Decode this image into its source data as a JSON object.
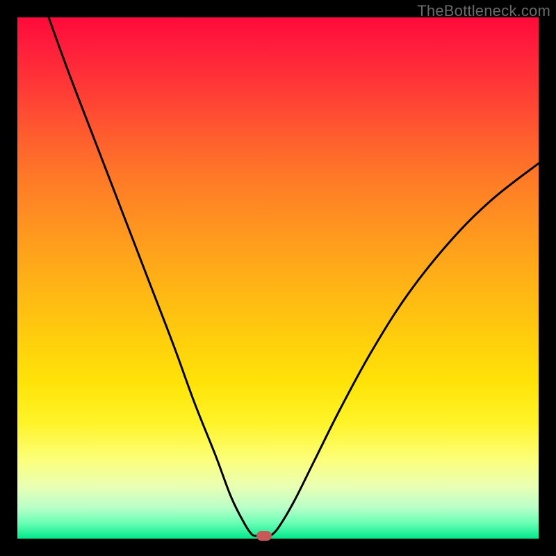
{
  "watermark": "TheBottleneck.com",
  "colors": {
    "frame": "#000000",
    "curve": "#000000",
    "marker": "#c75a58"
  },
  "chart_data": {
    "type": "line",
    "title": "",
    "xlabel": "",
    "ylabel": "",
    "xlim": [
      0,
      100
    ],
    "ylim": [
      0,
      100
    ],
    "grid": false,
    "series": [
      {
        "name": "left-branch",
        "x": [
          6,
          10,
          15,
          20,
          25,
          30,
          34,
          38,
          41,
          43.5,
          45,
          46
        ],
        "y": [
          100,
          89,
          76,
          63,
          50,
          37,
          26,
          16,
          8,
          3,
          0.8,
          0.5
        ]
      },
      {
        "name": "right-branch",
        "x": [
          48.5,
          50,
          53,
          57,
          62,
          68,
          75,
          83,
          91,
          100
        ],
        "y": [
          0.5,
          2,
          7,
          15,
          25,
          36,
          47,
          57,
          65,
          72
        ]
      }
    ],
    "marker": {
      "x": 47.3,
      "y": 0.5
    },
    "background_gradient_note": "red (high bottleneck) at top to green (no bottleneck) at bottom"
  }
}
